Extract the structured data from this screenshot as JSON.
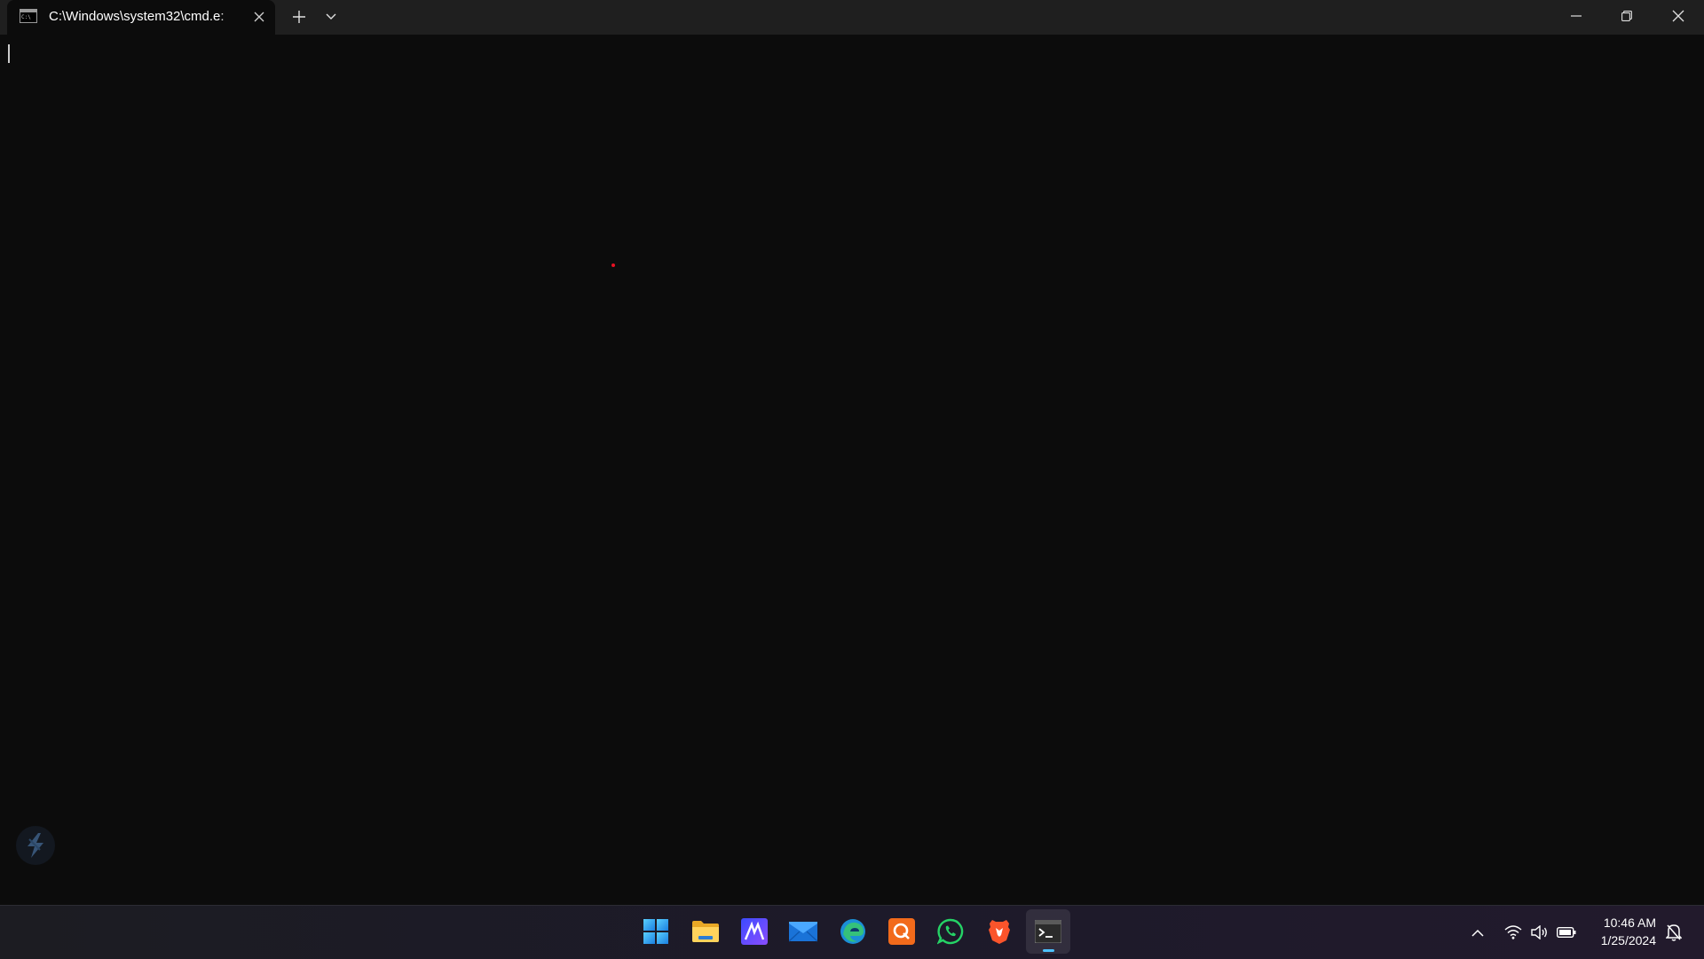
{
  "window": {
    "tab_title": "C:\\Windows\\system32\\cmd.e:",
    "tab_icon": "cmd-icon",
    "new_tab_icon": "plus-icon",
    "dropdown_icon": "chevron-down-icon",
    "controls": [
      "minimize-icon",
      "restore-icon",
      "close-icon"
    ]
  },
  "terminal": {
    "content": ""
  },
  "taskbar": {
    "apps": [
      {
        "name": "start-button",
        "icon": "windows-logo-icon",
        "active": false
      },
      {
        "name": "file-explorer",
        "icon": "folder-icon",
        "active": false
      },
      {
        "name": "app-m",
        "icon": "m-logo-icon",
        "active": false
      },
      {
        "name": "mail",
        "icon": "mail-icon",
        "active": false
      },
      {
        "name": "edge",
        "icon": "edge-icon",
        "active": false
      },
      {
        "name": "app-q",
        "icon": "q-logo-icon",
        "active": false
      },
      {
        "name": "whatsapp",
        "icon": "whatsapp-icon",
        "active": false
      },
      {
        "name": "brave",
        "icon": "brave-icon",
        "active": false
      },
      {
        "name": "terminal",
        "icon": "terminal-icon",
        "active": true
      }
    ],
    "tray": {
      "icons": [
        "chevron-up-icon",
        "wifi-icon",
        "volume-icon",
        "battery-icon",
        "notification-bell-icon"
      ],
      "time": "10:46 AM",
      "date": "1/25/2024"
    }
  },
  "colors": {
    "terminal_bg": "#0c0c0c",
    "titlebar_bg": "#1f1f1f",
    "accent": "#4cc2ff",
    "cursor_dot": "#e81123"
  }
}
